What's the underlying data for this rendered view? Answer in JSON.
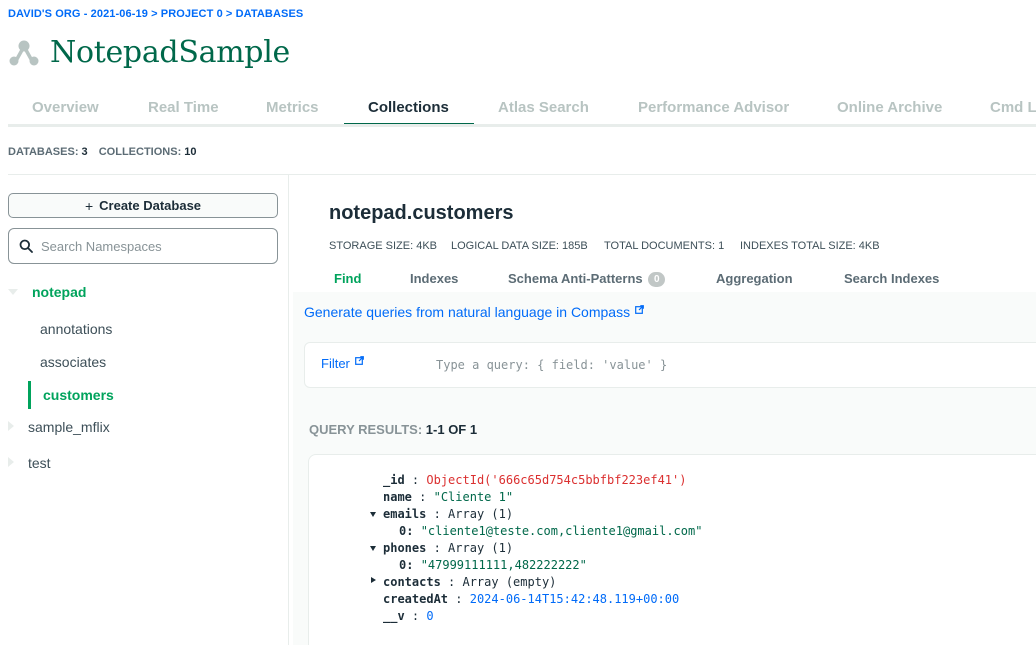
{
  "breadcrumb": "DAVID'S ORG - 2021-06-19 > PROJECT 0 > DATABASES",
  "page_title": "NotepadSample",
  "tabs": [
    "Overview",
    "Real Time",
    "Metrics",
    "Collections",
    "Atlas Search",
    "Performance Advisor",
    "Online Archive",
    "Cmd Line Tools"
  ],
  "counts": {
    "databases_label": "DATABASES:",
    "databases": "3",
    "collections_label": "COLLECTIONS:",
    "collections": "10"
  },
  "sidebar": {
    "create_label": "Create Database",
    "search_placeholder": "Search Namespaces",
    "databases": [
      {
        "name": "notepad",
        "collections": [
          "annotations",
          "associates",
          "customers"
        ]
      },
      {
        "name": "sample_mflix"
      },
      {
        "name": "test"
      }
    ]
  },
  "collection": {
    "title": "notepad.customers",
    "stats": [
      "STORAGE SIZE: 4KB",
      "LOGICAL DATA SIZE: 185B",
      "TOTAL DOCUMENTS: 1",
      "INDEXES TOTAL SIZE: 4KB"
    ],
    "subtabs": [
      "Find",
      "Indexes",
      "Schema Anti-Patterns",
      "Aggregation",
      "Search Indexes"
    ],
    "anti_patterns_count": "0"
  },
  "nl_link": "Generate queries from natural language in Compass",
  "filter": {
    "label": "Filter",
    "placeholder": "Type a query: { field: 'value' }"
  },
  "results": {
    "label": "QUERY RESULTS:",
    "range": "1-1 OF 1"
  },
  "document": {
    "id_key": "_id",
    "id_value": "ObjectId('666c65d754c5bbfbf223ef41')",
    "name_key": "name",
    "name_value": "\"Cliente 1\"",
    "emails_key": "emails",
    "emails_type": "Array (1)",
    "emails_index": "0:",
    "emails_value": "\"cliente1@teste.com,cliente1@gmail.com\"",
    "phones_key": "phones",
    "phones_type": "Array (1)",
    "phones_index": "0:",
    "phones_value": "\"47999111111,482222222\"",
    "contacts_key": "contacts",
    "contacts_type": "Array (empty)",
    "created_key": "createdAt",
    "created_value": "2024-06-14T15:42:48.119+00:00",
    "v_key": "__v",
    "v_value": "0"
  },
  "colors": {
    "brand_green": "#00684a",
    "accent_green": "#00a35c",
    "link_blue": "#016bf8",
    "objectid_red": "#db3030"
  }
}
